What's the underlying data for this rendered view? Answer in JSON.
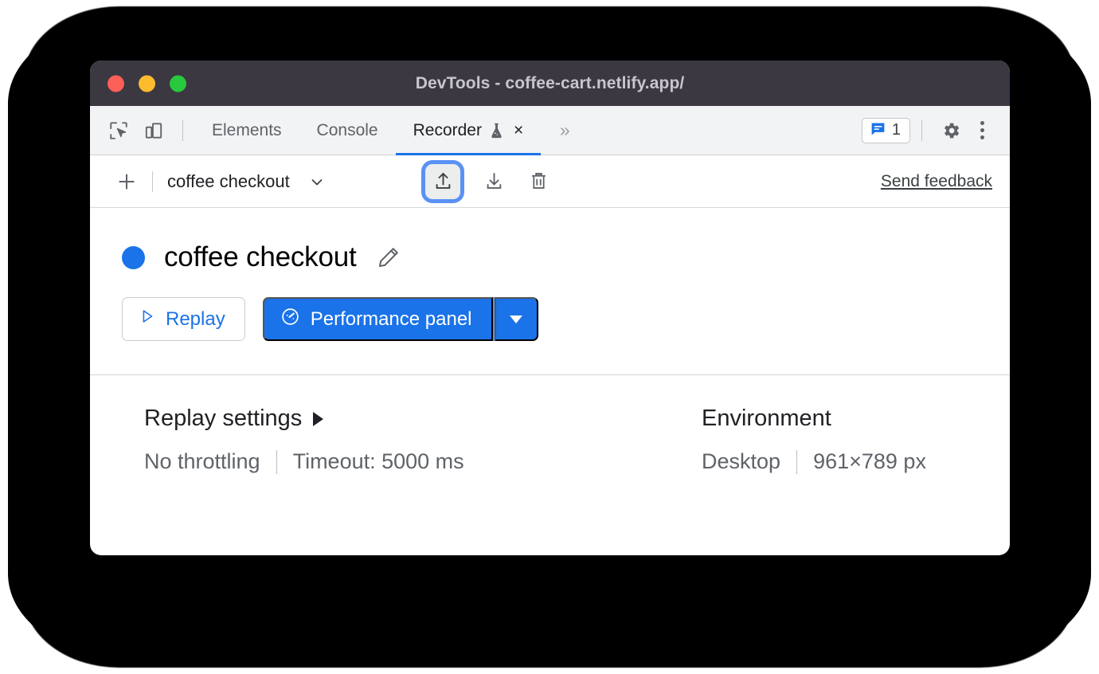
{
  "window": {
    "title": "DevTools - coffee-cart.netlify.app/",
    "traffic_lights": [
      "close",
      "minimize",
      "maximize"
    ],
    "colors": {
      "titlebar_bg": "#3b3842",
      "accent_blue": "#1a73e8",
      "focus_ring": "#5a91f5",
      "red": "#fc5f58",
      "yellow": "#fdbc2d",
      "green": "#28c83f"
    }
  },
  "tabbar": {
    "inspect_icon": "inspect-element-icon",
    "device_icon": "device-toolbar-icon",
    "tabs": [
      {
        "label": "Elements",
        "active": false
      },
      {
        "label": "Console",
        "active": false
      },
      {
        "label": "Recorder",
        "active": true,
        "experimental": true,
        "closable": true
      }
    ],
    "close_label": "×",
    "more_tabs_label": "»",
    "issues": {
      "icon": "issues-message-icon",
      "count": "1"
    },
    "settings_icon": "gear-icon",
    "kebab_icon": "more-options-icon"
  },
  "recorder_toolbar": {
    "add_label": "+",
    "recording_name": "coffee checkout",
    "chevron_icon": "chevron-down-icon",
    "import_icon": "import-upload-icon",
    "export_icon": "export-download-icon",
    "delete_icon": "trash-icon",
    "feedback_label": "Send feedback"
  },
  "recording": {
    "title": "coffee checkout",
    "edit_icon": "pencil-edit-icon",
    "replay_label": "Replay",
    "replay_icon": "play-triangle-icon",
    "perf_label": "Performance panel",
    "perf_icon": "performance-gauge-icon",
    "perf_dropdown_icon": "caret-down-icon"
  },
  "settings": {
    "replay": {
      "heading": "Replay settings",
      "expand_icon": "caret-right-icon",
      "throttling": "No throttling",
      "timeout": "Timeout: 5000 ms"
    },
    "environment": {
      "heading": "Environment",
      "device": "Desktop",
      "viewport": "961×789 px"
    }
  }
}
